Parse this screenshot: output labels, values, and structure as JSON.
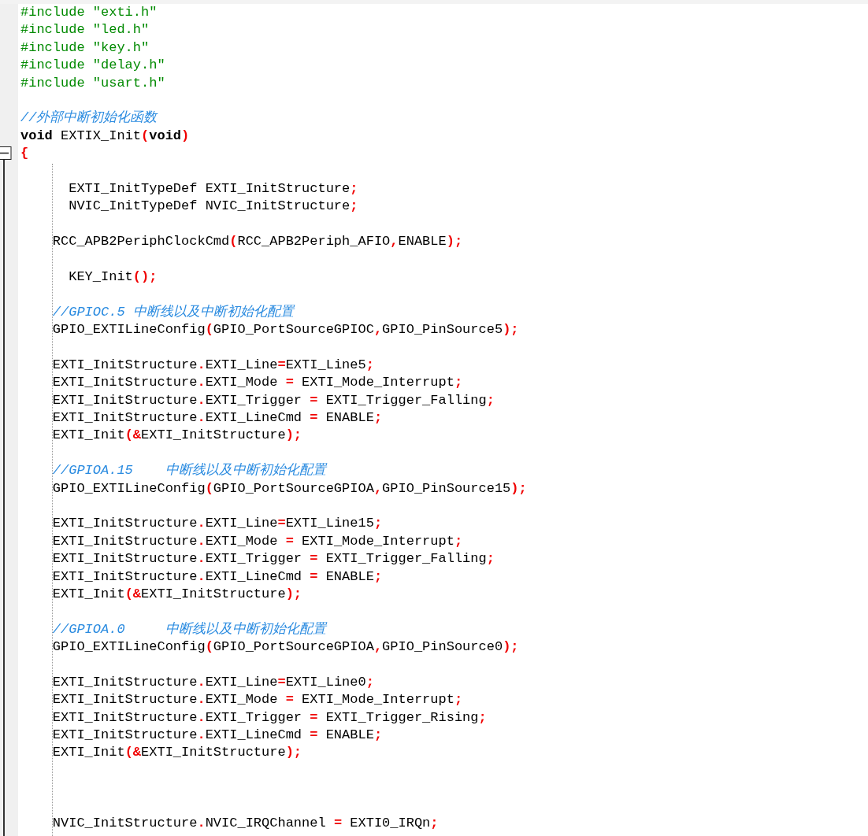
{
  "editor": {
    "lines": [
      {
        "kind": "code",
        "tokens": [
          {
            "kind": "directive",
            "text": "#include \"exti.h\""
          }
        ]
      },
      {
        "kind": "code",
        "tokens": [
          {
            "kind": "directive",
            "text": "#include \"led.h\""
          }
        ]
      },
      {
        "kind": "code",
        "tokens": [
          {
            "kind": "directive",
            "text": "#include \"key.h\""
          }
        ]
      },
      {
        "kind": "code",
        "tokens": [
          {
            "kind": "directive",
            "text": "#include \"delay.h\""
          }
        ]
      },
      {
        "kind": "code",
        "tokens": [
          {
            "kind": "directive",
            "text": "#include \"usart.h\""
          }
        ]
      },
      {
        "kind": "blank"
      },
      {
        "kind": "code",
        "tokens": [
          {
            "kind": "comment",
            "text": "//外部中断初始化函数"
          }
        ]
      },
      {
        "kind": "code",
        "tokens": [
          {
            "kind": "keyword",
            "text": "void"
          },
          {
            "kind": "plain",
            "text": " EXTIX_Init"
          },
          {
            "kind": "punct",
            "text": "("
          },
          {
            "kind": "keyword",
            "text": "void"
          },
          {
            "kind": "punct",
            "text": ")"
          }
        ]
      },
      {
        "kind": "code",
        "fold": {
          "expanded": true
        },
        "tokens": [
          {
            "kind": "punct",
            "text": "{"
          }
        ]
      },
      {
        "kind": "blank"
      },
      {
        "kind": "code",
        "tokens": [
          {
            "kind": "plain",
            "text": "      EXTI_InitTypeDef EXTI_InitStructure"
          },
          {
            "kind": "punct",
            "text": ";"
          }
        ]
      },
      {
        "kind": "code",
        "tokens": [
          {
            "kind": "plain",
            "text": "      NVIC_InitTypeDef NVIC_InitStructure"
          },
          {
            "kind": "punct",
            "text": ";"
          }
        ]
      },
      {
        "kind": "blank"
      },
      {
        "kind": "code",
        "tokens": [
          {
            "kind": "plain",
            "text": "    RCC_APB2PeriphClockCmd"
          },
          {
            "kind": "punct",
            "text": "("
          },
          {
            "kind": "plain",
            "text": "RCC_APB2Periph_AFIO"
          },
          {
            "kind": "punct",
            "text": ","
          },
          {
            "kind": "plain",
            "text": "ENABLE"
          },
          {
            "kind": "punct",
            "text": ");"
          }
        ]
      },
      {
        "kind": "blank"
      },
      {
        "kind": "code",
        "tokens": [
          {
            "kind": "plain",
            "text": "      KEY_Init"
          },
          {
            "kind": "punct",
            "text": "();"
          }
        ]
      },
      {
        "kind": "blank"
      },
      {
        "kind": "code",
        "tokens": [
          {
            "kind": "comment",
            "text": "    //GPIOC.5 中断线以及中断初始化配置"
          }
        ]
      },
      {
        "kind": "code",
        "tokens": [
          {
            "kind": "plain",
            "text": "    GPIO_EXTILineConfig"
          },
          {
            "kind": "punct",
            "text": "("
          },
          {
            "kind": "plain",
            "text": "GPIO_PortSourceGPIOC"
          },
          {
            "kind": "punct",
            "text": ","
          },
          {
            "kind": "plain",
            "text": "GPIO_PinSource5"
          },
          {
            "kind": "punct",
            "text": ");"
          }
        ]
      },
      {
        "kind": "blank"
      },
      {
        "kind": "code",
        "tokens": [
          {
            "kind": "plain",
            "text": "    EXTI_InitStructure"
          },
          {
            "kind": "punct",
            "text": "."
          },
          {
            "kind": "plain",
            "text": "EXTI_Line"
          },
          {
            "kind": "punct",
            "text": "="
          },
          {
            "kind": "plain",
            "text": "EXTI_Line5"
          },
          {
            "kind": "punct",
            "text": ";"
          }
        ]
      },
      {
        "kind": "code",
        "tokens": [
          {
            "kind": "plain",
            "text": "    EXTI_InitStructure"
          },
          {
            "kind": "punct",
            "text": "."
          },
          {
            "kind": "plain",
            "text": "EXTI_Mode "
          },
          {
            "kind": "punct",
            "text": "="
          },
          {
            "kind": "plain",
            "text": " EXTI_Mode_Interrupt"
          },
          {
            "kind": "punct",
            "text": ";"
          }
        ]
      },
      {
        "kind": "code",
        "tokens": [
          {
            "kind": "plain",
            "text": "    EXTI_InitStructure"
          },
          {
            "kind": "punct",
            "text": "."
          },
          {
            "kind": "plain",
            "text": "EXTI_Trigger "
          },
          {
            "kind": "punct",
            "text": "="
          },
          {
            "kind": "plain",
            "text": " EXTI_Trigger_Falling"
          },
          {
            "kind": "punct",
            "text": ";"
          }
        ]
      },
      {
        "kind": "code",
        "tokens": [
          {
            "kind": "plain",
            "text": "    EXTI_InitStructure"
          },
          {
            "kind": "punct",
            "text": "."
          },
          {
            "kind": "plain",
            "text": "EXTI_LineCmd "
          },
          {
            "kind": "punct",
            "text": "="
          },
          {
            "kind": "plain",
            "text": " ENABLE"
          },
          {
            "kind": "punct",
            "text": ";"
          }
        ]
      },
      {
        "kind": "code",
        "tokens": [
          {
            "kind": "plain",
            "text": "    EXTI_Init"
          },
          {
            "kind": "punct",
            "text": "(&"
          },
          {
            "kind": "plain",
            "text": "EXTI_InitStructure"
          },
          {
            "kind": "punct",
            "text": ");"
          }
        ]
      },
      {
        "kind": "blank"
      },
      {
        "kind": "code",
        "tokens": [
          {
            "kind": "comment",
            "text": "    //GPIOA.15    中断线以及中断初始化配置"
          }
        ]
      },
      {
        "kind": "code",
        "tokens": [
          {
            "kind": "plain",
            "text": "    GPIO_EXTILineConfig"
          },
          {
            "kind": "punct",
            "text": "("
          },
          {
            "kind": "plain",
            "text": "GPIO_PortSourceGPIOA"
          },
          {
            "kind": "punct",
            "text": ","
          },
          {
            "kind": "plain",
            "text": "GPIO_PinSource15"
          },
          {
            "kind": "punct",
            "text": ");"
          }
        ]
      },
      {
        "kind": "blank"
      },
      {
        "kind": "code",
        "tokens": [
          {
            "kind": "plain",
            "text": "    EXTI_InitStructure"
          },
          {
            "kind": "punct",
            "text": "."
          },
          {
            "kind": "plain",
            "text": "EXTI_Line"
          },
          {
            "kind": "punct",
            "text": "="
          },
          {
            "kind": "plain",
            "text": "EXTI_Line15"
          },
          {
            "kind": "punct",
            "text": ";"
          }
        ]
      },
      {
        "kind": "code",
        "tokens": [
          {
            "kind": "plain",
            "text": "    EXTI_InitStructure"
          },
          {
            "kind": "punct",
            "text": "."
          },
          {
            "kind": "plain",
            "text": "EXTI_Mode "
          },
          {
            "kind": "punct",
            "text": "="
          },
          {
            "kind": "plain",
            "text": " EXTI_Mode_Interrupt"
          },
          {
            "kind": "punct",
            "text": ";"
          }
        ]
      },
      {
        "kind": "code",
        "tokens": [
          {
            "kind": "plain",
            "text": "    EXTI_InitStructure"
          },
          {
            "kind": "punct",
            "text": "."
          },
          {
            "kind": "plain",
            "text": "EXTI_Trigger "
          },
          {
            "kind": "punct",
            "text": "="
          },
          {
            "kind": "plain",
            "text": " EXTI_Trigger_Falling"
          },
          {
            "kind": "punct",
            "text": ";"
          }
        ]
      },
      {
        "kind": "code",
        "tokens": [
          {
            "kind": "plain",
            "text": "    EXTI_InitStructure"
          },
          {
            "kind": "punct",
            "text": "."
          },
          {
            "kind": "plain",
            "text": "EXTI_LineCmd "
          },
          {
            "kind": "punct",
            "text": "="
          },
          {
            "kind": "plain",
            "text": " ENABLE"
          },
          {
            "kind": "punct",
            "text": ";"
          }
        ]
      },
      {
        "kind": "code",
        "tokens": [
          {
            "kind": "plain",
            "text": "    EXTI_Init"
          },
          {
            "kind": "punct",
            "text": "(&"
          },
          {
            "kind": "plain",
            "text": "EXTI_InitStructure"
          },
          {
            "kind": "punct",
            "text": ");"
          }
        ]
      },
      {
        "kind": "blank"
      },
      {
        "kind": "code",
        "tokens": [
          {
            "kind": "comment",
            "text": "    //GPIOA.0     中断线以及中断初始化配置"
          }
        ]
      },
      {
        "kind": "code",
        "tokens": [
          {
            "kind": "plain",
            "text": "    GPIO_EXTILineConfig"
          },
          {
            "kind": "punct",
            "text": "("
          },
          {
            "kind": "plain",
            "text": "GPIO_PortSourceGPIOA"
          },
          {
            "kind": "punct",
            "text": ","
          },
          {
            "kind": "plain",
            "text": "GPIO_PinSource0"
          },
          {
            "kind": "punct",
            "text": ");"
          }
        ]
      },
      {
        "kind": "blank"
      },
      {
        "kind": "code",
        "tokens": [
          {
            "kind": "plain",
            "text": "    EXTI_InitStructure"
          },
          {
            "kind": "punct",
            "text": "."
          },
          {
            "kind": "plain",
            "text": "EXTI_Line"
          },
          {
            "kind": "punct",
            "text": "="
          },
          {
            "kind": "plain",
            "text": "EXTI_Line0"
          },
          {
            "kind": "punct",
            "text": ";"
          }
        ]
      },
      {
        "kind": "code",
        "tokens": [
          {
            "kind": "plain",
            "text": "    EXTI_InitStructure"
          },
          {
            "kind": "punct",
            "text": "."
          },
          {
            "kind": "plain",
            "text": "EXTI_Mode "
          },
          {
            "kind": "punct",
            "text": "="
          },
          {
            "kind": "plain",
            "text": " EXTI_Mode_Interrupt"
          },
          {
            "kind": "punct",
            "text": ";"
          }
        ]
      },
      {
        "kind": "code",
        "tokens": [
          {
            "kind": "plain",
            "text": "    EXTI_InitStructure"
          },
          {
            "kind": "punct",
            "text": "."
          },
          {
            "kind": "plain",
            "text": "EXTI_Trigger "
          },
          {
            "kind": "punct",
            "text": "="
          },
          {
            "kind": "plain",
            "text": " EXTI_Trigger_Rising"
          },
          {
            "kind": "punct",
            "text": ";"
          }
        ]
      },
      {
        "kind": "code",
        "tokens": [
          {
            "kind": "plain",
            "text": "    EXTI_InitStructure"
          },
          {
            "kind": "punct",
            "text": "."
          },
          {
            "kind": "plain",
            "text": "EXTI_LineCmd "
          },
          {
            "kind": "punct",
            "text": "="
          },
          {
            "kind": "plain",
            "text": " ENABLE"
          },
          {
            "kind": "punct",
            "text": ";"
          }
        ]
      },
      {
        "kind": "code",
        "tokens": [
          {
            "kind": "plain",
            "text": "    EXTI_Init"
          },
          {
            "kind": "punct",
            "text": "(&"
          },
          {
            "kind": "plain",
            "text": "EXTI_InitStructure"
          },
          {
            "kind": "punct",
            "text": ");"
          }
        ]
      },
      {
        "kind": "blank"
      },
      {
        "kind": "blank"
      },
      {
        "kind": "blank"
      },
      {
        "kind": "code",
        "tokens": [
          {
            "kind": "plain",
            "text": "    NVIC_InitStructure"
          },
          {
            "kind": "punct",
            "text": "."
          },
          {
            "kind": "plain",
            "text": "NVIC_IRQChannel "
          },
          {
            "kind": "punct",
            "text": "="
          },
          {
            "kind": "plain",
            "text": " EXTI0_IRQn"
          },
          {
            "kind": "punct",
            "text": ";"
          }
        ]
      }
    ]
  }
}
